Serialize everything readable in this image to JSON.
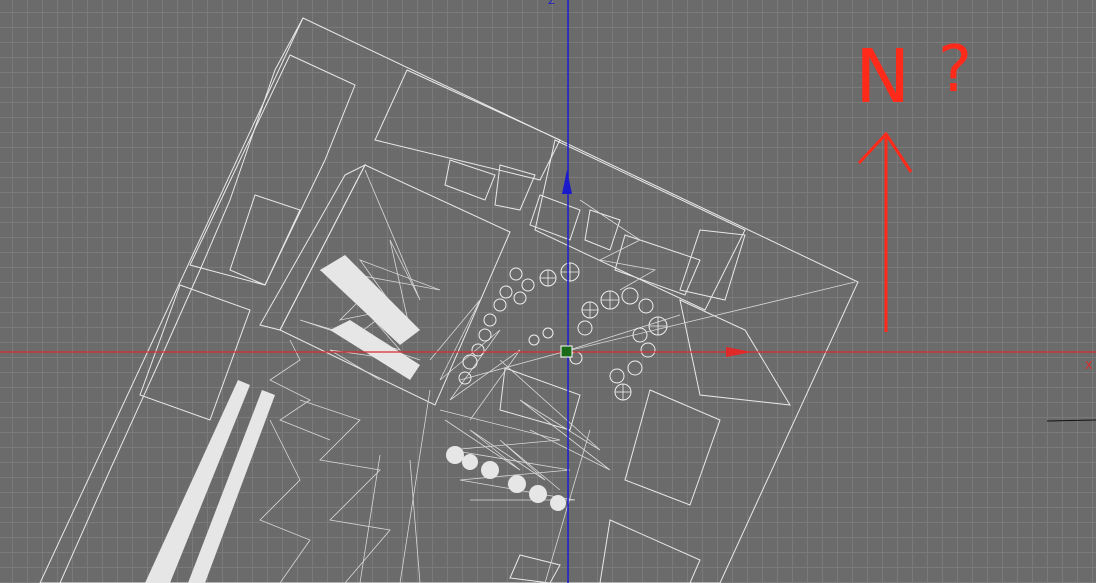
{
  "viewport": {
    "axes": {
      "z_label": "Z",
      "x_label": "X",
      "x_color": "#e02a2a",
      "z_color": "#1a1acc"
    },
    "grid_color": "#7a7a7a",
    "background_color": "#6b6b6b",
    "wireframe_color": "#e9e9e9",
    "pivot_color": "#1a6a1a"
  },
  "annotation": {
    "north_label": "N",
    "question_mark": "?",
    "arrow_color": "#ff2a1a",
    "arrow_icon": "arrow-up-icon"
  }
}
